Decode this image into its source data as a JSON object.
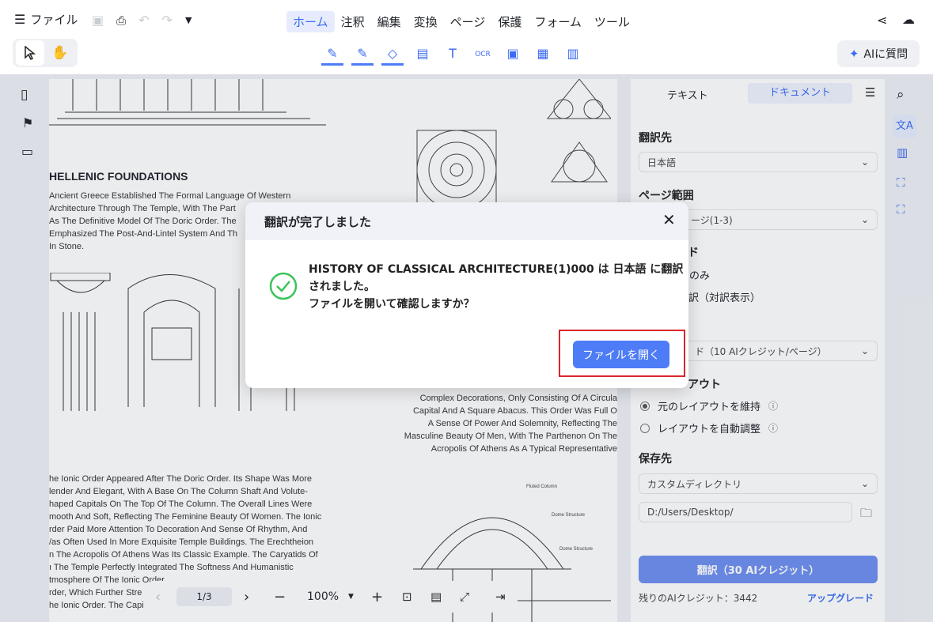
{
  "topbar": {
    "file_label": "ファイル",
    "tabs": [
      {
        "label": "ホーム",
        "active": true
      },
      {
        "label": "注釈"
      },
      {
        "label": "編集"
      },
      {
        "label": "変換"
      },
      {
        "label": "ページ"
      },
      {
        "label": "保護"
      },
      {
        "label": "フォーム"
      },
      {
        "label": "ツール"
      }
    ],
    "accent_color": "#3b6bf2"
  },
  "toolbar": {
    "ask_ai_label": "AIに質問"
  },
  "document": {
    "heading": "HELLENIC FOUNDATIONS",
    "para1": [
      "Ancient Greece Established The Formal Language Of Western",
      "Architecture Through The Temple, With The Part",
      "As The Definitive Model Of The Doric Order. The",
      "Emphasized The Post-And-Lintel System And Th",
      "In Stone."
    ],
    "para2": [
      "Complex Decorations, Only Consisting Of A Circula",
      "Capital And A Square Abacus. This Order Was Full O",
      "A Sense Of Power And Solemnity, Reflecting The",
      "Masculine Beauty Of Men, With The Parthenon On The",
      "Acropolis Of Athens As A Typical Representative"
    ],
    "para3": [
      "he Ionic Order Appeared After The Doric Order. Its Shape Was More",
      "lender And Elegant, With A Base On The Column Shaft And Volute-",
      "haped Capitals On The Top Of The Column. The Overall Lines Were",
      "mooth And Soft, Reflecting The Feminine Beauty Of Women. The Ionic",
      "rder Paid More Attention To Decoration And Sense Of Rhythm, And",
      "/as Often Used In More Exquisite Temple Buildings. The Erechtheion",
      "n The Acropolis Of Athens Was Its Classic Example. The Caryatids Of",
      "ı The Temple Perfectly Integrated The Softness And Humanistic",
      "tmosphere Of The Ionic Order,",
      "rder, Which Further Stre",
      "he Ionic Order. The Capi"
    ],
    "dome_labels": [
      "Fluted Column",
      "Dome Structure",
      "Dome Structure"
    ]
  },
  "bottombar": {
    "page": "1/3",
    "zoom": "100%"
  },
  "panel": {
    "tabs": [
      {
        "label": "テキスト"
      },
      {
        "label": "ドキュメント",
        "active": true
      }
    ],
    "target_lang_title": "翻訳先",
    "target_lang_value": "日本語",
    "page_range_title": "ページ範囲",
    "page_range_value": "ージ(1-3)",
    "mode_title_fragment": "ド",
    "mode_option1": "のみ",
    "mode_option2": "翻訳（対訳表示）",
    "quality_value": "ド（10 AIクレジット/ページ）",
    "layout_title_fragment": "アウト",
    "layout_option1": "元のレイアウトを維持",
    "layout_option2": "レイアウトを自動調整",
    "save_title": "保存先",
    "save_dir_value": "カスタムディレクトリ",
    "save_path_value": "D:/Users/Desktop/",
    "translate_button": "翻訳（30 AIクレジット）",
    "credits_left": "残りのAIクレジット：3442",
    "upgrade_link": "アップグレード"
  },
  "dialog": {
    "title": "翻訳が完了しました",
    "message_line1": "HISTORY OF CLASSICAL ARCHITECTURE(1)000 は 日本語 に翻訳",
    "message_line2": "されました。",
    "message_line3": "ファイルを開いて確認しますか？",
    "open_button": "ファイルを開く",
    "success_color": "#3cc35a",
    "highlight_color": "#d9262c"
  }
}
